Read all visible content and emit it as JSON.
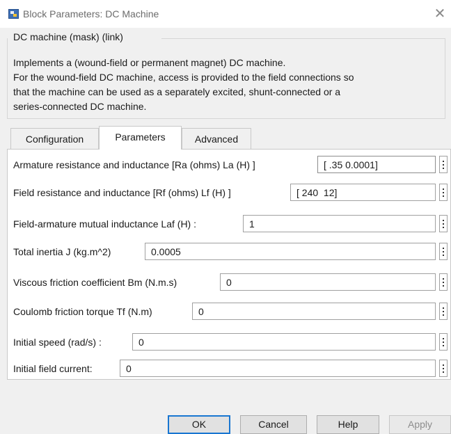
{
  "window": {
    "title": "Block Parameters: DC Machine",
    "app_icon": "simulink-block-icon",
    "close_icon": "close-icon"
  },
  "description": {
    "group_title": "DC machine (mask) (link)",
    "lines": [
      "Implements a (wound-field or permanent magnet) DC machine.",
      "For the wound-field DC machine, access is provided to the field connections so",
      "that the machine can be used as a separately excited, shunt-connected or a",
      "series-connected  DC machine."
    ]
  },
  "tabs": [
    {
      "label": "Configuration",
      "active": false
    },
    {
      "label": "Parameters",
      "active": true
    },
    {
      "label": "Advanced",
      "active": false
    }
  ],
  "params": [
    {
      "label": "Armature resistance and inductance [Ra (ohms) La (H) ]",
      "value": "[ .35 0.0001]"
    },
    {
      "label": "Field resistance and inductance [Rf (ohms) Lf (H) ]",
      "value": "[ 240  12]"
    },
    {
      "label": "Field-armature mutual inductance Laf (H) :",
      "value": "1"
    },
    {
      "label": "Total inertia J (kg.m^2)",
      "value": "0.0005"
    },
    {
      "label": "Viscous friction coefficient Bm (N.m.s)",
      "value": "0"
    },
    {
      "label": "Coulomb friction torque Tf (N.m)",
      "value": "0"
    },
    {
      "label": "Initial speed (rad/s) :",
      "value": "0"
    },
    {
      "label": "Initial field current:",
      "value": "0"
    }
  ],
  "buttons": {
    "ok": "OK",
    "cancel": "Cancel",
    "help": "Help",
    "apply": "Apply"
  },
  "colors": {
    "default_button_border": "#1876d1",
    "panel_background": "#ffffff",
    "dialog_background": "#f0f0f0"
  }
}
